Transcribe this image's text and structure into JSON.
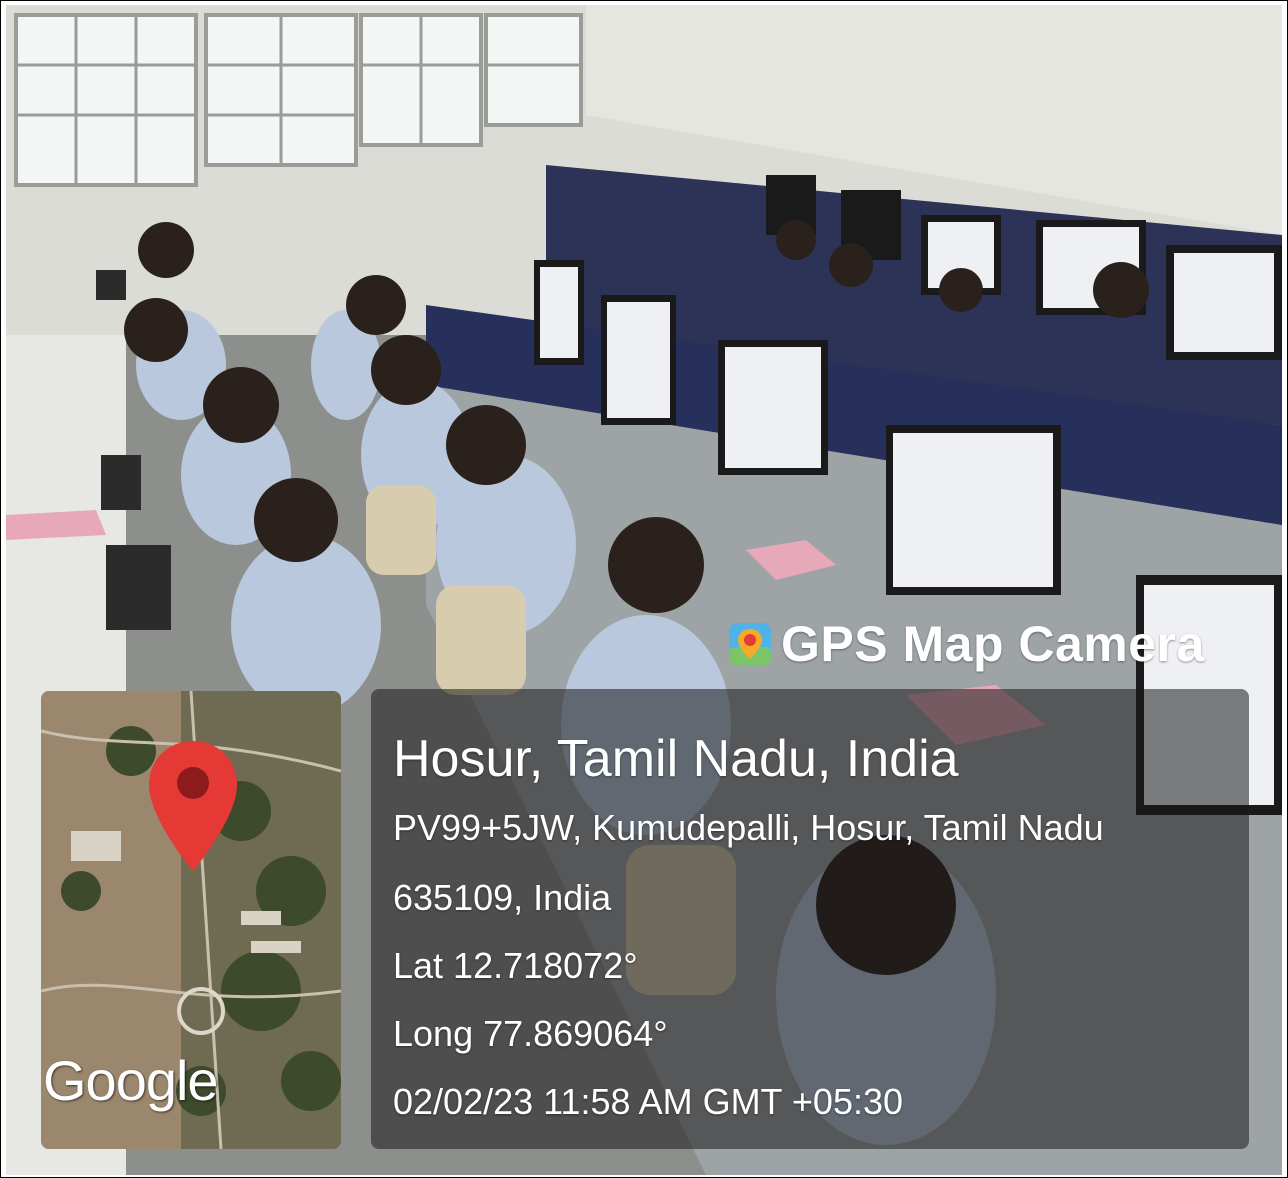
{
  "overlay": {
    "brand": "GPS Map Camera",
    "location_title": "Hosur, Tamil Nadu, India",
    "address_line1": "PV99+5JW, Kumudepalli, Hosur, Tamil Nadu",
    "address_line2": "635109, India",
    "latitude": "Lat 12.718072°",
    "longitude": "Long 77.869064°",
    "datetime": "02/02/23 11:58 AM GMT +05:30"
  },
  "map": {
    "provider_logo": "Google",
    "pin_icon": "map-pin-icon"
  },
  "colors": {
    "pin_red": "#e53935",
    "overlay_bg": "#191919"
  }
}
